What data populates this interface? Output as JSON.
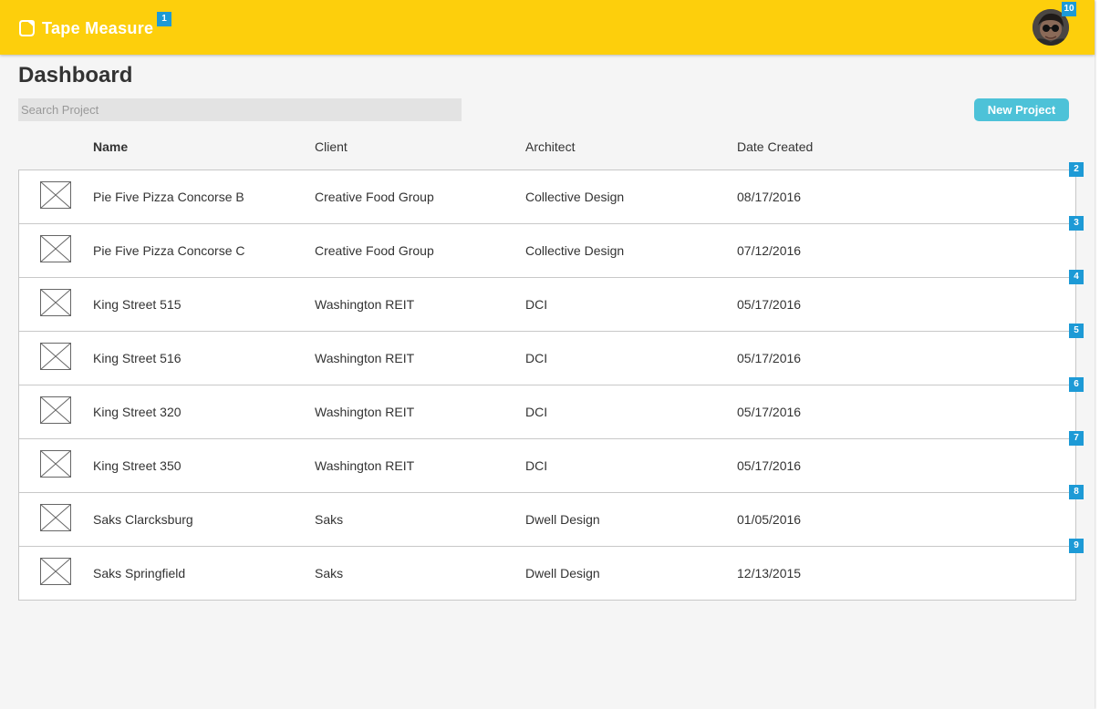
{
  "header": {
    "app_name": "Tape Measure",
    "brand_color": "#fdcf0c",
    "logo_marker": "1",
    "avatar_marker": "10"
  },
  "page": {
    "title": "Dashboard"
  },
  "search": {
    "placeholder": "Search Project",
    "value": ""
  },
  "actions": {
    "new_project_label": "New Project",
    "accent_color": "#4dc2d8"
  },
  "table": {
    "columns": [
      "Name",
      "Client",
      "Architect",
      "Date Created"
    ],
    "rows": [
      {
        "marker": "2",
        "name": "Pie Five Pizza Concorse B",
        "client": "Creative Food Group",
        "architect": "Collective Design",
        "date": "08/17/2016",
        "icon": "image-placeholder-icon"
      },
      {
        "marker": "3",
        "name": "Pie Five Pizza Concorse C",
        "client": "Creative Food Group",
        "architect": "Collective Design",
        "date": "07/12/2016",
        "icon": "image-placeholder-icon"
      },
      {
        "marker": "4",
        "name": "King Street 515",
        "client": "Washington REIT",
        "architect": "DCI",
        "date": "05/17/2016",
        "icon": "image-placeholder-icon"
      },
      {
        "marker": "5",
        "name": "King Street 516",
        "client": "Washington REIT",
        "architect": "DCI",
        "date": "05/17/2016",
        "icon": "image-placeholder-icon"
      },
      {
        "marker": "6",
        "name": "King Street 320",
        "client": "Washington REIT",
        "architect": "DCI",
        "date": "05/17/2016",
        "icon": "image-placeholder-icon"
      },
      {
        "marker": "7",
        "name": "King Street 350",
        "client": "Washington REIT",
        "architect": "DCI",
        "date": "05/17/2016",
        "icon": "image-placeholder-icon"
      },
      {
        "marker": "8",
        "name": "Saks Clarcksburg",
        "client": "Saks",
        "architect": "Dwell Design",
        "date": "01/05/2016",
        "icon": "image-placeholder-icon"
      },
      {
        "marker": "9",
        "name": "Saks Springfield",
        "client": "Saks",
        "architect": "Dwell Design",
        "date": "12/13/2015",
        "icon": "image-placeholder-icon"
      }
    ]
  },
  "marker_color": "#1d9ad6"
}
